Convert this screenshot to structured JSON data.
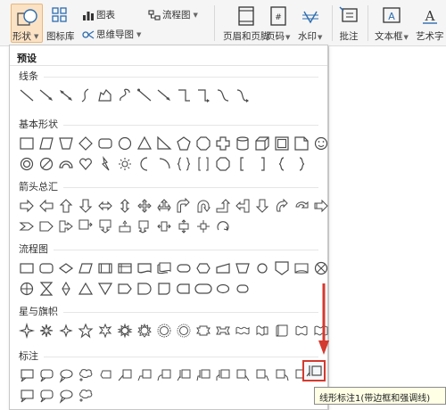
{
  "ribbon": {
    "shape_label": "形状",
    "icon_library_label": "图标库",
    "chart_label": "图表",
    "mindmap_label": "思维导图",
    "flowchart_label": "流程图",
    "header_footer_label": "页眉和页脚",
    "page_number_label": "页码",
    "watermark_label": "水印",
    "comment_label": "批注",
    "textbox_label": "文本框",
    "wordart_label": "艺术字"
  },
  "dropdown": {
    "title": "预设",
    "sections": [
      {
        "label": "线条",
        "rows": [
          12
        ]
      },
      {
        "label": "基本形状",
        "rows": [
          16,
          15
        ]
      },
      {
        "label": "箭头总汇",
        "rows": [
          16,
          11
        ]
      },
      {
        "label": "流程图",
        "rows": [
          16,
          12
        ]
      },
      {
        "label": "星与旗帜",
        "rows": [
          16
        ]
      },
      {
        "label": "标注",
        "rows": [
          15,
          4
        ]
      }
    ]
  },
  "tooltip": {
    "text": "线形标注1(带边框和强调线)"
  },
  "colors": {
    "accent_red": "#d43a2f",
    "shape_btn_bg": "#fbe2c4",
    "icon_stroke": "#4a4a4a",
    "icon_blue": "#2b6cb0"
  }
}
